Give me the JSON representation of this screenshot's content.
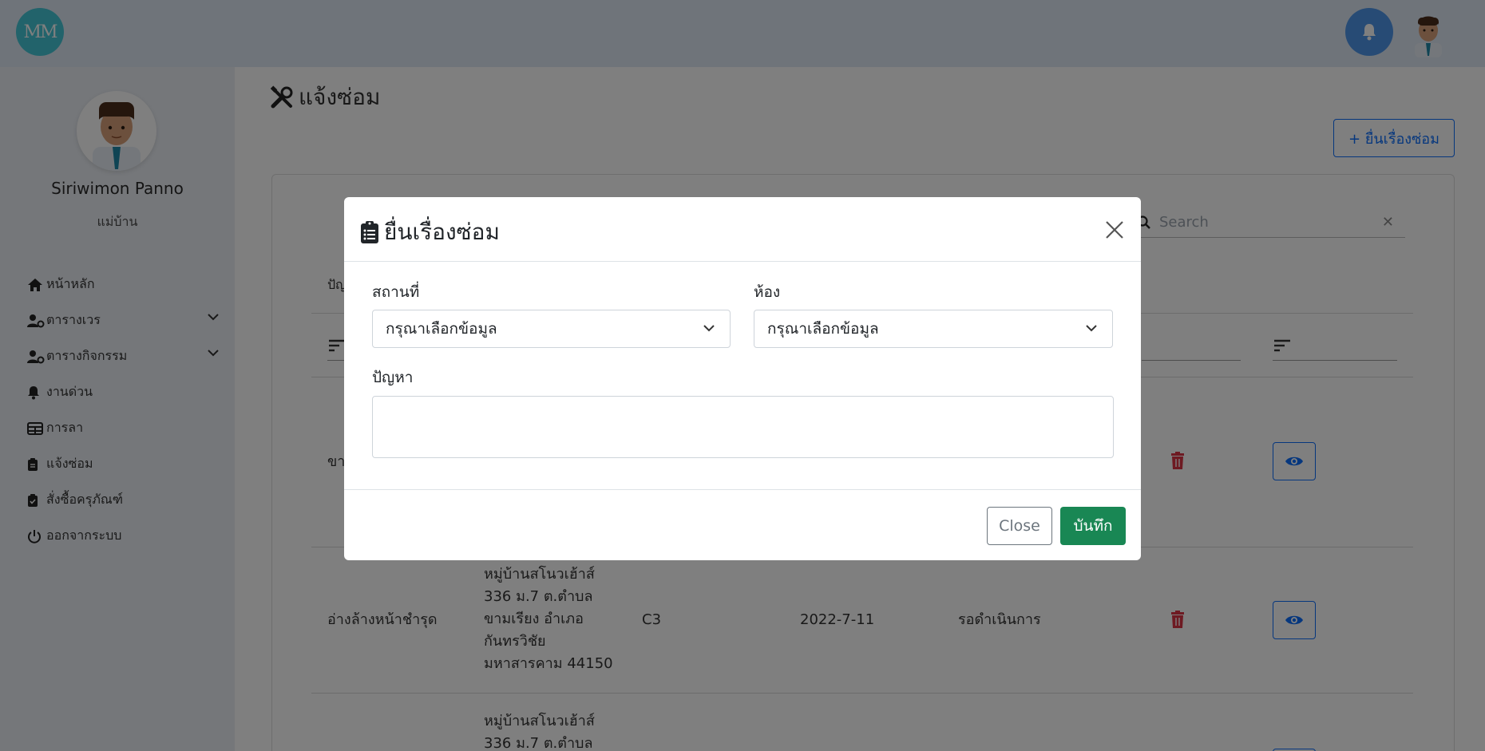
{
  "header": {
    "logo_text": "MM",
    "notification_icon": "bell-icon",
    "avatar_icon": "user-avatar"
  },
  "sidebar": {
    "user_name": "Siriwimon Panno",
    "user_role": "แม่บ้าน",
    "items": [
      {
        "label": "หน้าหลัก",
        "icon": "home-icon",
        "has_submenu": false
      },
      {
        "label": "ตารางเวร",
        "icon": "user-gear-icon",
        "has_submenu": true
      },
      {
        "label": "ตารางกิจกรรม",
        "icon": "user-gear-icon",
        "has_submenu": true
      },
      {
        "label": "งานด่วน",
        "icon": "bell-icon",
        "has_submenu": false
      },
      {
        "label": "การลา",
        "icon": "table-icon",
        "has_submenu": false
      },
      {
        "label": "แจ้งซ่อม",
        "icon": "clipboard-icon",
        "has_submenu": false
      },
      {
        "label": "สั่งซื้อครุภัณฑ์",
        "icon": "clipboard-check-icon",
        "has_submenu": false
      },
      {
        "label": "ออกจากระบบ",
        "icon": "power-icon",
        "has_submenu": false
      }
    ]
  },
  "main": {
    "page_title": "แจ้งซ่อม",
    "add_button_label": "+ ยื่นเรื่องซ่อม",
    "search_placeholder": "Search",
    "column_partial": "ปัญ",
    "rows": [
      {
        "problem": "ขา",
        "address": "",
        "room": "",
        "date": "",
        "status": ""
      },
      {
        "problem": "อ่างล้างหน้าชำรุด",
        "address": "หมู่บ้านสโนวเฮ้าส์ 336 ม.7 ต.ตำบล ขามเรียง อำเภอ กันทรวิชัย มหาสารคาม 44150",
        "address_lines": [
          "หมู่บ้านสโนวเฮ้าส์",
          "336 ม.7 ต.ตำบล",
          "ขามเรียง อำเภอ",
          "กันทรวิชัย",
          "มหาสารคาม 44150"
        ],
        "room": "C3",
        "date": "2022-7-11",
        "status": "รอดำเนินการ"
      },
      {
        "problem": "",
        "address_lines": [
          "หมู่บ้านสโนวเฮ้าส์",
          "336 ม.7 ต.ตำบล"
        ],
        "room": "",
        "date": "",
        "status": ""
      }
    ]
  },
  "modal": {
    "title": "ยื่นเรื่องซ่อม",
    "location_label": "สถานที่",
    "location_value": "กรุณาเลือกข้อมูล",
    "room_label": "ห้อง",
    "room_value": "กรุณาเลือกข้อมูล",
    "problem_label": "ปัญหา",
    "problem_value": "",
    "close_label": "Close",
    "save_label": "บันทึก"
  },
  "colors": {
    "primary": "#0d6efd",
    "success": "#198754",
    "danger": "#dc3545",
    "logo": "#45c6d6",
    "bell": "#4f97ea"
  }
}
